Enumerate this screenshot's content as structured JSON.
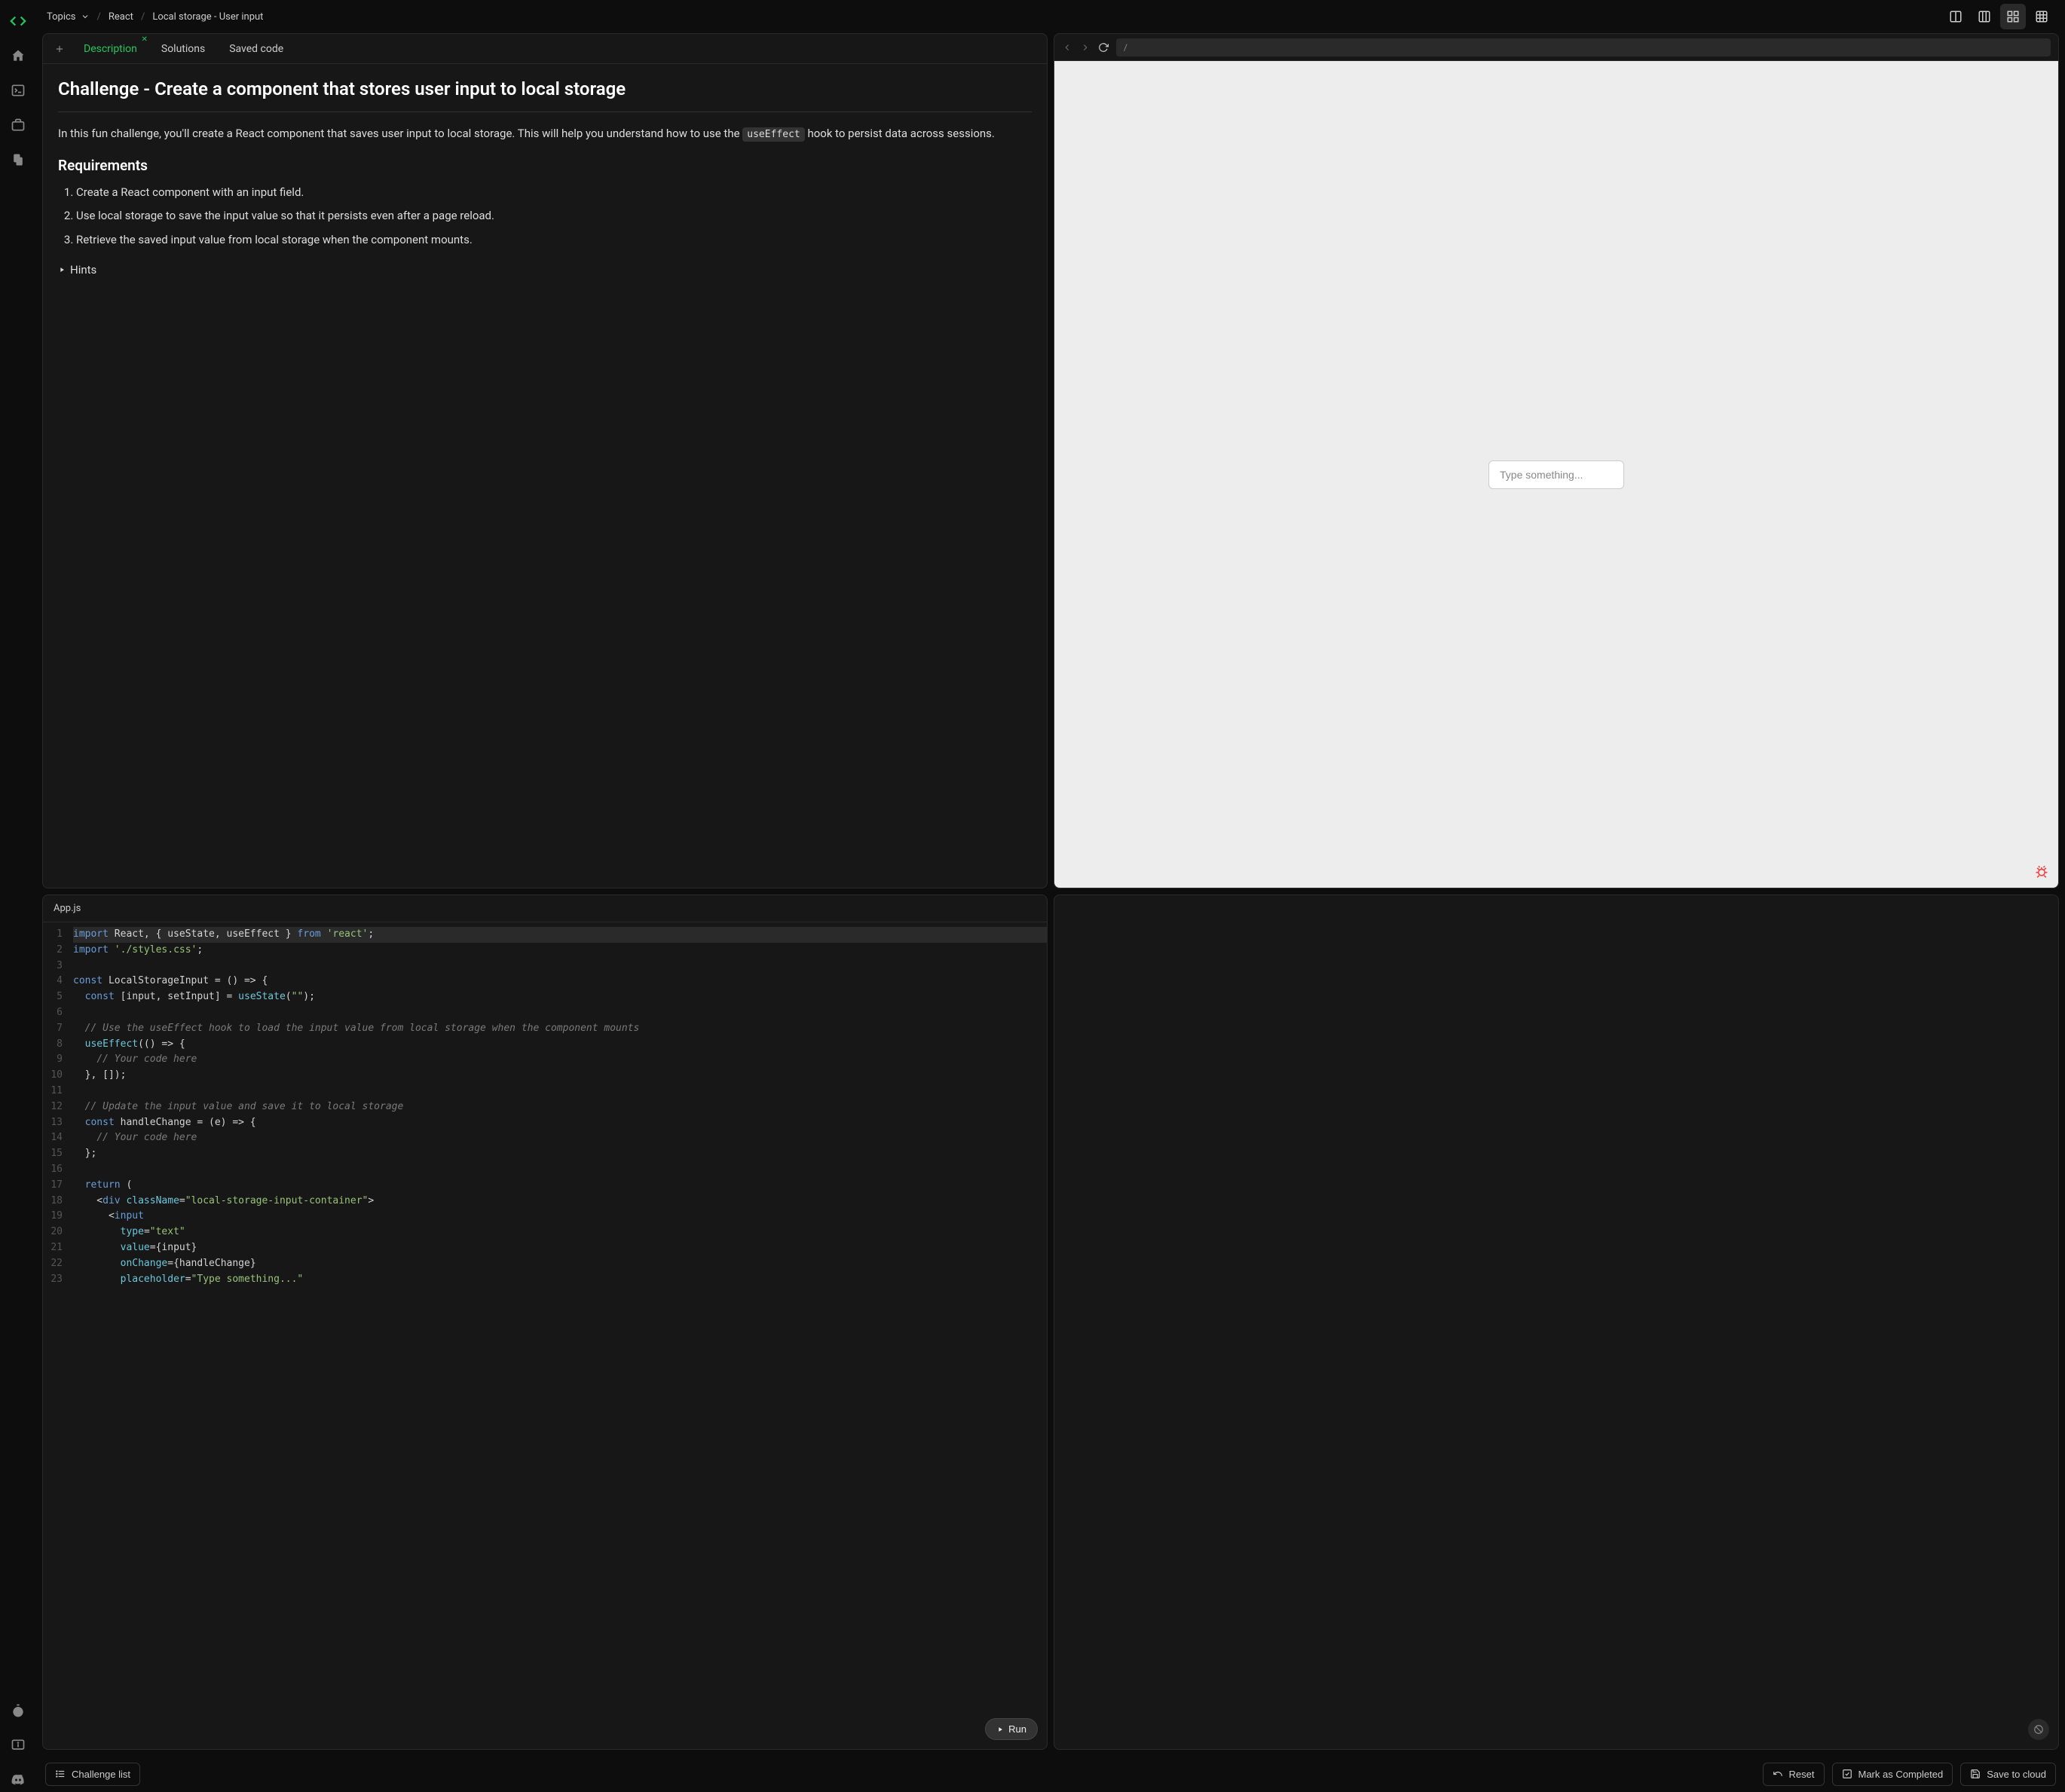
{
  "breadcrumb": {
    "topics_label": "Topics",
    "framework": "React",
    "page": "Local storage - User input"
  },
  "tabs": {
    "description": "Description",
    "solutions": "Solutions",
    "saved_code": "Saved code"
  },
  "challenge": {
    "title": "Challenge - Create a component that stores user input to local storage",
    "intro_before": "In this fun challenge, you'll create a React component that saves user input to local storage. This will help you understand how to use the ",
    "intro_code": "useEffect",
    "intro_after": " hook to persist data across sessions.",
    "requirements_heading": "Requirements",
    "requirements": [
      "Create a React component with an input field.",
      "Use local storage to save the input value so that it persists even after a page reload.",
      "Retrieve the saved input value from local storage when the component mounts."
    ],
    "hints_label": "Hints"
  },
  "editor": {
    "filename": "App.js",
    "run_label": "Run",
    "lines": [
      [
        [
          "kw",
          "import"
        ],
        [
          "pl",
          " React, { useState, useEffect } "
        ],
        [
          "kw",
          "from"
        ],
        [
          "pl",
          " "
        ],
        [
          "str",
          "'react'"
        ],
        [
          "pl",
          ";"
        ]
      ],
      [
        [
          "kw",
          "import"
        ],
        [
          "pl",
          " "
        ],
        [
          "str",
          "'./styles.css'"
        ],
        [
          "pl",
          ";"
        ]
      ],
      [
        [
          "pl",
          ""
        ]
      ],
      [
        [
          "kw",
          "const"
        ],
        [
          "pl",
          " LocalStorageInput = () => {"
        ]
      ],
      [
        [
          "pl",
          "  "
        ],
        [
          "kw",
          "const"
        ],
        [
          "pl",
          " [input, setInput] = "
        ],
        [
          "fn",
          "useState"
        ],
        [
          "pl",
          "("
        ],
        [
          "str",
          "\"\""
        ],
        [
          "pl",
          ");"
        ]
      ],
      [
        [
          "pl",
          ""
        ]
      ],
      [
        [
          "pl",
          "  "
        ],
        [
          "cm",
          "// Use the useEffect hook to load the input value from local storage when the component mounts"
        ]
      ],
      [
        [
          "pl",
          "  "
        ],
        [
          "fn",
          "useEffect"
        ],
        [
          "pl",
          "(() => {"
        ]
      ],
      [
        [
          "pl",
          "    "
        ],
        [
          "cm",
          "// Your code here"
        ]
      ],
      [
        [
          "pl",
          "  }, []);"
        ]
      ],
      [
        [
          "pl",
          ""
        ]
      ],
      [
        [
          "pl",
          "  "
        ],
        [
          "cm",
          "// Update the input value and save it to local storage"
        ]
      ],
      [
        [
          "pl",
          "  "
        ],
        [
          "kw",
          "const"
        ],
        [
          "pl",
          " handleChange = (e) => {"
        ]
      ],
      [
        [
          "pl",
          "    "
        ],
        [
          "cm",
          "// Your code here"
        ]
      ],
      [
        [
          "pl",
          "  };"
        ]
      ],
      [
        [
          "pl",
          ""
        ]
      ],
      [
        [
          "pl",
          "  "
        ],
        [
          "kw",
          "return"
        ],
        [
          "pl",
          " ("
        ]
      ],
      [
        [
          "pl",
          "    <"
        ],
        [
          "tag",
          "div"
        ],
        [
          "pl",
          " "
        ],
        [
          "attr",
          "className"
        ],
        [
          "pl",
          "="
        ],
        [
          "str",
          "\"local-storage-input-container\""
        ],
        [
          "pl",
          ">"
        ]
      ],
      [
        [
          "pl",
          "      <"
        ],
        [
          "tag",
          "input"
        ]
      ],
      [
        [
          "pl",
          "        "
        ],
        [
          "attr",
          "type"
        ],
        [
          "pl",
          "="
        ],
        [
          "str",
          "\"text\""
        ]
      ],
      [
        [
          "pl",
          "        "
        ],
        [
          "attr",
          "value"
        ],
        [
          "pl",
          "={input}"
        ]
      ],
      [
        [
          "pl",
          "        "
        ],
        [
          "attr",
          "onChange"
        ],
        [
          "pl",
          "={handleChange}"
        ]
      ],
      [
        [
          "pl",
          "        "
        ],
        [
          "attr",
          "placeholder"
        ],
        [
          "pl",
          "="
        ],
        [
          "str",
          "\"Type something...\""
        ]
      ]
    ]
  },
  "preview": {
    "url": "/",
    "input_placeholder": "Type something..."
  },
  "bottom": {
    "challenge_list": "Challenge list",
    "reset": "Reset",
    "mark_completed": "Mark as Completed",
    "save_cloud": "Save to cloud"
  }
}
